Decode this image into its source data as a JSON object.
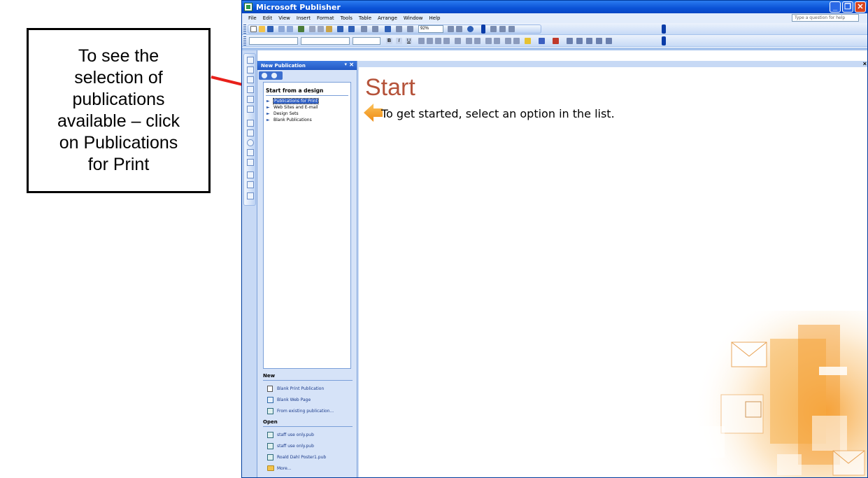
{
  "callout": {
    "text": "To see the\nselection of\npublications\navailable – click\non Publications\nfor Print"
  },
  "window": {
    "title": "Microsoft Publisher",
    "help_placeholder": "Type a question for help",
    "menu": [
      "File",
      "Edit",
      "View",
      "Insert",
      "Format",
      "Tools",
      "Table",
      "Arrange",
      "Window",
      "Help"
    ],
    "zoom": "92%"
  },
  "task_pane": {
    "title": "New Publication",
    "start_from_label": "Start from a design",
    "design_items": [
      "Publications for Print",
      "Web Sites and E-mail",
      "Design Sets",
      "Blank Publications"
    ],
    "new_section": "New",
    "new_items": [
      "Blank Print Publication",
      "Blank Web Page",
      "From existing publication..."
    ],
    "open_section": "Open",
    "open_items": [
      "staff use only.pub",
      "staff use only.pub",
      "Roald Dahl Poster1.pub",
      "More..."
    ]
  },
  "document": {
    "heading": "Start",
    "instruction": "To get started, select an option in the list."
  },
  "colors": {
    "title_bar": "#0a52d6",
    "heading": "#b5533a",
    "arrow": "#e8201a",
    "art_orange": "#f5a43c"
  }
}
